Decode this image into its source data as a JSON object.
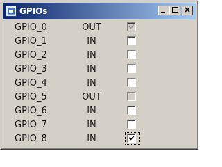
{
  "window": {
    "title": "GPIOs",
    "icon": "app-icon",
    "title_gradient": [
      "#0a246a",
      "#a6caf0"
    ],
    "buttons": {
      "minimize_icon": "minimize-icon",
      "maximize_icon": "maximize-icon",
      "close_icon": "close-icon"
    }
  },
  "gpio_list": [
    {
      "name": "GPIO_0",
      "direction": "OUT",
      "checked": true,
      "enabled": false,
      "focused": false
    },
    {
      "name": "GPIO_1",
      "direction": "IN",
      "checked": false,
      "enabled": true,
      "focused": false
    },
    {
      "name": "GPIO_2",
      "direction": "IN",
      "checked": false,
      "enabled": true,
      "focused": false
    },
    {
      "name": "GPIO_3",
      "direction": "IN",
      "checked": false,
      "enabled": true,
      "focused": false
    },
    {
      "name": "GPIO_4",
      "direction": "IN",
      "checked": false,
      "enabled": true,
      "focused": false
    },
    {
      "name": "GPIO_5",
      "direction": "OUT",
      "checked": false,
      "enabled": false,
      "focused": false
    },
    {
      "name": "GPIO_6",
      "direction": "IN",
      "checked": false,
      "enabled": true,
      "focused": false
    },
    {
      "name": "GPIO_7",
      "direction": "IN",
      "checked": false,
      "enabled": true,
      "focused": false
    },
    {
      "name": "GPIO_8",
      "direction": "IN",
      "checked": true,
      "enabled": true,
      "focused": true
    }
  ]
}
